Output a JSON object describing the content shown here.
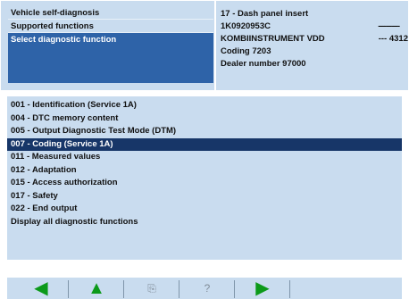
{
  "header": {
    "left_items": [
      "Vehicle self-diagnosis",
      "Supported functions",
      "Select diagnostic function"
    ],
    "right_lines": [
      "17 - Dash panel insert",
      "1K0920953C",
      "KOMBIINSTRUMENT VDD",
      "Coding 7203",
      "Dealer number 97000"
    ],
    "dashes": "-----------",
    "version_label": "--- 4312"
  },
  "functions": [
    "001 - Identification (Service 1A)",
    "004 - DTC memory content",
    "005 - Output Diagnostic Test Mode (DTM)",
    "007 - Coding (Service 1A)",
    "011 - Measured values",
    "012 - Adaptation",
    "015 - Access authorization",
    "017 - Safety",
    "022 - End output",
    "Display all diagnostic functions"
  ],
  "selected_function_index": 3,
  "toolbar": {
    "icons": [
      "arrow-left-icon",
      "arrow-up-icon",
      "print-icon",
      "help-icon",
      "arrow-right-icon"
    ],
    "accent": "#0c9a1a"
  },
  "colors": {
    "panel_bg": "#c9dcef",
    "selected_header_bg": "#2e63a8",
    "selected_row_bg": "#173668"
  }
}
